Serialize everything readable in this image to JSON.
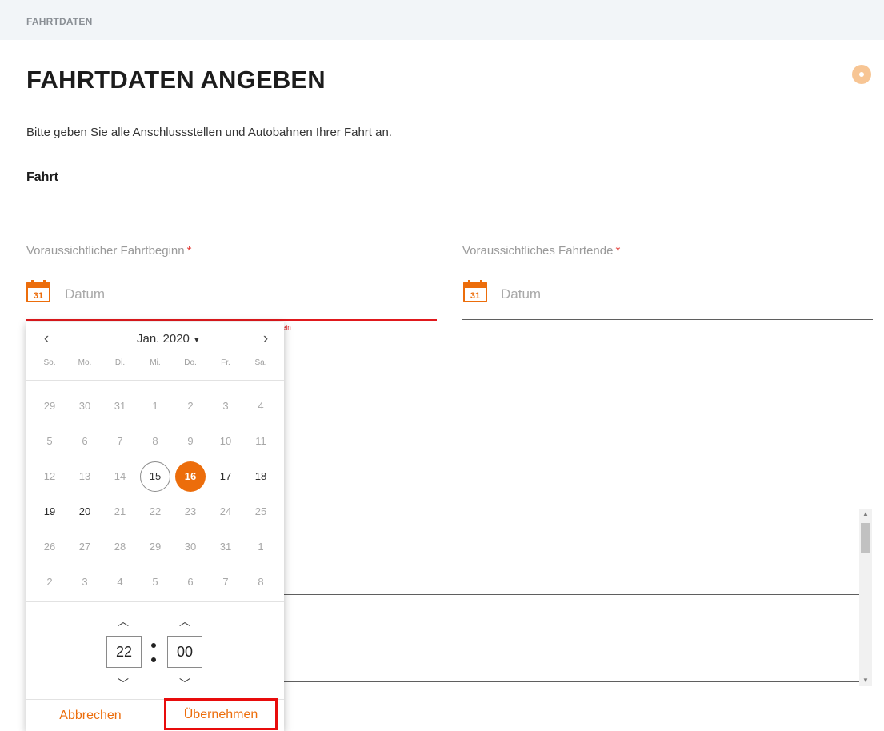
{
  "breadcrumb": "FAHRTDATEN",
  "page": {
    "title": "FAHRTDATEN ANGEBEN",
    "intro": "Bitte geben Sie alle Anschlussstellen und Autobahnen Ihrer Fahrt an.",
    "section_title": "Fahrt",
    "status_color": "#f7c594"
  },
  "fields": {
    "start": {
      "label": "Voraussichtlicher Fahrtbeginn",
      "required": "*",
      "placeholder": "Datum",
      "icon": "calendar-icon",
      "icon_day": "31",
      "error_visible_fragment": "ein"
    },
    "end": {
      "label": "Voraussichtliches Fahrtende",
      "required": "*",
      "placeholder": "Datum",
      "icon": "calendar-icon",
      "icon_day": "31"
    }
  },
  "datepicker": {
    "prev": "‹",
    "next": "›",
    "month_label": "Jan. 2020",
    "weekdays": [
      "So.",
      "Mo.",
      "Di.",
      "Mi.",
      "Do.",
      "Fr.",
      "Sa."
    ],
    "weeks": [
      [
        "29",
        "30",
        "31",
        "1",
        "2",
        "3",
        "4"
      ],
      [
        "5",
        "6",
        "7",
        "8",
        "9",
        "10",
        "11"
      ],
      [
        "12",
        "13",
        "14",
        "15",
        "16",
        "17",
        "18"
      ],
      [
        "19",
        "20",
        "21",
        "22",
        "23",
        "24",
        "25"
      ],
      [
        "26",
        "27",
        "28",
        "29",
        "30",
        "31",
        "1"
      ],
      [
        "2",
        "3",
        "4",
        "5",
        "6",
        "7",
        "8"
      ]
    ],
    "today": "15",
    "selected": "16",
    "enabled_days": [
      "17",
      "18",
      "19",
      "20"
    ],
    "time": {
      "hours": "22",
      "minutes": "00"
    },
    "cancel_label": "Abbrechen",
    "apply_label": "Übernehmen",
    "accent_color": "#ec6d0b"
  }
}
